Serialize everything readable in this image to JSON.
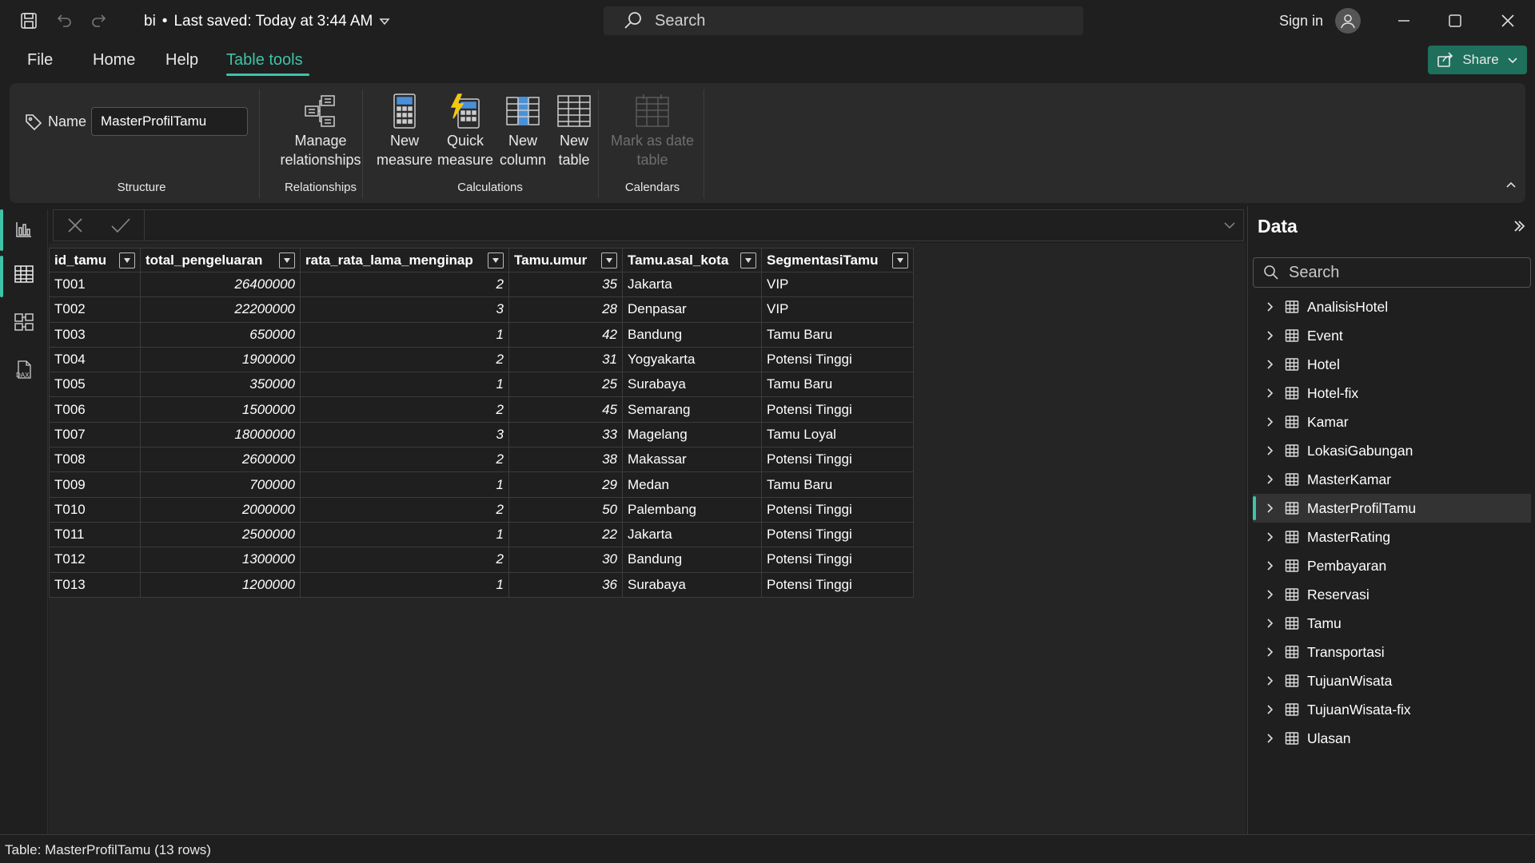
{
  "titlebar": {
    "doc_name": "bi",
    "separator": "•",
    "saved_status": "Last saved: Today at 3:44 AM",
    "search_placeholder": "Search",
    "sign_in": "Sign in"
  },
  "menu": {
    "items": [
      "File",
      "Home",
      "Help",
      "Table tools"
    ],
    "active": "Table tools",
    "share_label": "Share"
  },
  "ribbon": {
    "name_label": "Name",
    "name_value": "MasterProfilTamu",
    "buttons": [
      {
        "line1": "Manage",
        "line2": "relationships",
        "icon": "manage-relationships-icon"
      },
      {
        "line1": "New",
        "line2": "measure",
        "icon": "new-measure-icon"
      },
      {
        "line1": "Quick",
        "line2": "measure",
        "icon": "quick-measure-icon"
      },
      {
        "line1": "New",
        "line2": "column",
        "icon": "new-column-icon"
      },
      {
        "line1": "New",
        "line2": "table",
        "icon": "new-table-icon"
      },
      {
        "line1": "Mark as date",
        "line2": "table",
        "icon": "mark-date-table-icon",
        "disabled": true
      }
    ],
    "groups": [
      "Structure",
      "Relationships",
      "Calculations",
      "Calendars"
    ]
  },
  "table": {
    "columns": [
      "id_tamu",
      "total_pengeluaran",
      "rata_rata_lama_menginap",
      "Tamu.umur",
      "Tamu.asal_kota",
      "SegmentasiTamu"
    ],
    "rows": [
      [
        "T001",
        "26400000",
        "2",
        "35",
        "Jakarta",
        "VIP"
      ],
      [
        "T002",
        "22200000",
        "3",
        "28",
        "Denpasar",
        "VIP"
      ],
      [
        "T003",
        "650000",
        "1",
        "42",
        "Bandung",
        "Tamu Baru"
      ],
      [
        "T004",
        "1900000",
        "2",
        "31",
        "Yogyakarta",
        "Potensi Tinggi"
      ],
      [
        "T005",
        "350000",
        "1",
        "25",
        "Surabaya",
        "Tamu Baru"
      ],
      [
        "T006",
        "1500000",
        "2",
        "45",
        "Semarang",
        "Potensi Tinggi"
      ],
      [
        "T007",
        "18000000",
        "3",
        "33",
        "Magelang",
        "Tamu Loyal"
      ],
      [
        "T008",
        "2600000",
        "2",
        "38",
        "Makassar",
        "Potensi Tinggi"
      ],
      [
        "T009",
        "700000",
        "1",
        "29",
        "Medan",
        "Tamu Baru"
      ],
      [
        "T010",
        "2000000",
        "2",
        "50",
        "Palembang",
        "Potensi Tinggi"
      ],
      [
        "T011",
        "2500000",
        "1",
        "22",
        "Jakarta",
        "Potensi Tinggi"
      ],
      [
        "T012",
        "1300000",
        "2",
        "30",
        "Bandung",
        "Potensi Tinggi"
      ],
      [
        "T013",
        "1200000",
        "1",
        "36",
        "Surabaya",
        "Potensi Tinggi"
      ]
    ]
  },
  "data_pane": {
    "title": "Data",
    "search_placeholder": "Search",
    "tables": [
      "AnalisisHotel",
      "Event",
      "Hotel",
      "Hotel-fix",
      "Kamar",
      "LokasiGabungan",
      "MasterKamar",
      "MasterProfilTamu",
      "MasterRating",
      "Pembayaran",
      "Reservasi",
      "Tamu",
      "Transportasi",
      "TujuanWisata",
      "TujuanWisata-fix",
      "Ulasan"
    ],
    "selected": "MasterProfilTamu"
  },
  "status": {
    "text": "Table: MasterProfilTamu (13 rows)"
  },
  "colors": {
    "accent": "#3fc3a8",
    "share_bg": "#1e6f5c",
    "background": "#1f1f1f"
  }
}
